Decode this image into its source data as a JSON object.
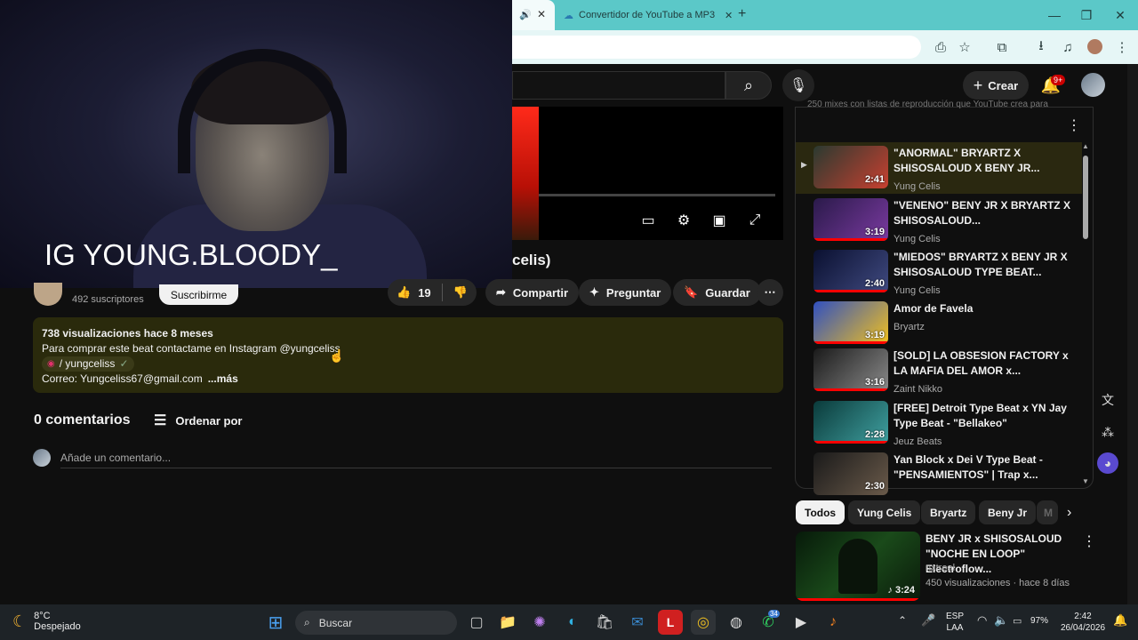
{
  "browser": {
    "tab2_title": "Convertidor de YouTube a MP3",
    "window_controls": {
      "minimize": "—",
      "maximize": "❐",
      "close": "✕"
    }
  },
  "youtube_header": {
    "create_label": "Crear",
    "notification_badge": "9+"
  },
  "webcam": {
    "overlay_text": "IG YOUNG.BLOODY_"
  },
  "video": {
    "title_fragment": "celis)",
    "channel_subscribers": "492 suscriptores",
    "subscribe_label": "Suscribirme",
    "likes": "19",
    "share_label": "Compartir",
    "ask_label": "Preguntar",
    "save_label": "Guardar"
  },
  "description": {
    "stats": "738 visualizaciones  hace 8 meses",
    "line1": "Para comprar este beat contactame en Instagram @yungceliss",
    "instagram_handle": "/ yungceliss",
    "email_line": "Correo: Yungceliss67@gmail.com",
    "more_label": "...más"
  },
  "comments": {
    "count_label": "0 comentarios",
    "sort_label": "Ordenar por",
    "input_placeholder": "Añade un comentario..."
  },
  "playlist": {
    "header_text": "250 mixes con listas de reproducción que YouTube crea para",
    "items": [
      {
        "title": "\"ANORMAL\" BRYARTZ X SHISOSALOUD X BENY JR...",
        "channel": "Yung Celis",
        "duration": "2:41",
        "active": true,
        "color1": "#2a3a30",
        "color2": "#c84030"
      },
      {
        "title": "\"VENENO\" BENY JR X BRYARTZ X SHISOSALOUD...",
        "channel": "Yung Celis",
        "duration": "3:19",
        "active": false,
        "color1": "#2a1a4a",
        "color2": "#7a3aa0"
      },
      {
        "title": "\"MIEDOS\" BRYARTZ X BENY JR X SHISOSALOUD TYPE BEAT...",
        "channel": "Yung Celis",
        "duration": "2:40",
        "active": false,
        "color1": "#0a1030",
        "color2": "#404a80"
      },
      {
        "title": "Amor de Favela",
        "channel": "Bryartz",
        "duration": "3:19",
        "active": false,
        "color1": "#3050c0",
        "color2": "#f0c020"
      },
      {
        "title": "[SOLD] LA OBSESION FACTORY x LA MAFIA DEL AMOR x...",
        "channel": "Zaint Nikko",
        "duration": "3:16",
        "active": false,
        "color1": "#1a1a1a",
        "color2": "#8a8a8a"
      },
      {
        "title": "[FREE] Detroit Type Beat x YN Jay Type Beat - \"Bellakeo\"",
        "channel": "Jeuz Beats",
        "duration": "2:28",
        "active": false,
        "color1": "#0a3a3a",
        "color2": "#40a0a0"
      },
      {
        "title": "Yan Block x Dei V Type Beat - \"PENSAMIENTOS\" | Trap x...",
        "channel": "",
        "duration": "2:30",
        "active": false,
        "color1": "#1a1a1a",
        "color2": "#6a5a4a"
      }
    ]
  },
  "chips": [
    "Todos",
    "Yung Celis",
    "Bryartz",
    "Beny Jr",
    "M"
  ],
  "recommended": {
    "title": "BENY JR x SHISOSALOUD \"NOCHE EN LOOP\" Electroflow...",
    "channel": "nxtreal",
    "meta": "450 visualizaciones · hace 8 días",
    "duration": "3:24"
  },
  "taskbar": {
    "weather_temp": "8°C",
    "weather_desc": "Despejado",
    "search_placeholder": "Buscar",
    "lang1": "ESP",
    "lang2": "LAA",
    "battery": "97%",
    "time": "2:42",
    "date": "26/04/2026",
    "whatsapp_badge": "34"
  }
}
